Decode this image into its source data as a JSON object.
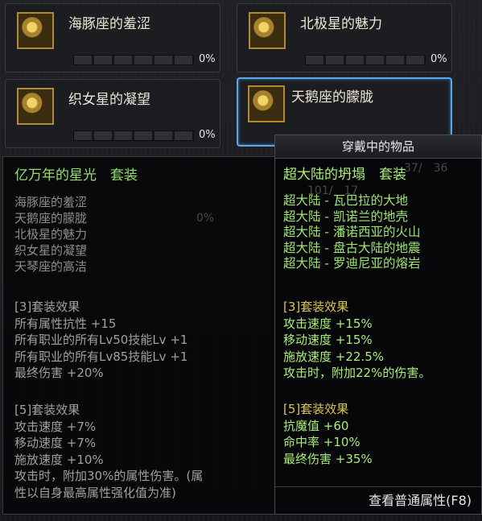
{
  "slots": [
    {
      "name": "海豚座的羞涩",
      "percent": "0%",
      "fill": 0
    },
    {
      "name": "北极星的魅力",
      "percent": "0%",
      "fill": 0
    },
    {
      "name": "织女星的凝望",
      "percent": "0%",
      "fill": 0
    },
    {
      "name": "天鹅座的朦胧",
      "percent": "",
      "fill": 0
    }
  ],
  "left_tooltip": {
    "set_name": "亿万年的星光　套装",
    "members": [
      "海豚座的羞涩",
      "天鹅座的朦胧",
      "北极星的魅力",
      "织女星的凝望",
      "天琴座的高洁"
    ],
    "ghost_percent": "0%",
    "effect3": {
      "title": "[3]套装效果",
      "lines": [
        "所有属性抗性 +15",
        "所有职业的所有Lv50技能Lv +1",
        "所有职业的所有Lv85技能Lv +1",
        "最终伤害 +20%"
      ]
    },
    "effect5": {
      "title": "[5]套装效果",
      "lines": [
        "攻击速度 +7%",
        "移动速度 +7%",
        "施放速度 +10%",
        "攻击时，附加30%的属性伤害。(属",
        "性以自身最高属性强化值为准)"
      ]
    }
  },
  "right_tooltip": {
    "header": "穿戴中的物品",
    "set_name": "超大陆的坍塌　套装",
    "ghost_numbers": "37/　36",
    "ghost_numbers2": "101/　17",
    "parts": [
      "超大陆 - 瓦巴拉的大地",
      "超大陆 - 凯诺兰的地壳",
      "超大陆 - 潘诺西亚的火山",
      "超大陆 - 盘古大陆的地震",
      "超大陆 - 罗迪尼亚的熔岩"
    ],
    "effect3": {
      "title": "[3]套装效果",
      "lines": [
        "攻击速度 +15%",
        "移动速度 +15%",
        "施放速度 +22.5%",
        "攻击时，附加22%的伤害。"
      ]
    },
    "effect5": {
      "title": "[5]套装效果",
      "lines": [
        "抗魔值 +60",
        "命中率 +10%",
        "最终伤害 +35%"
      ]
    },
    "footer": "查看普通属性(F8)"
  },
  "colors": {
    "set_green": "#8fe06a",
    "effect_head": "#d9c74a",
    "selected_border": "#5aa8e8"
  }
}
